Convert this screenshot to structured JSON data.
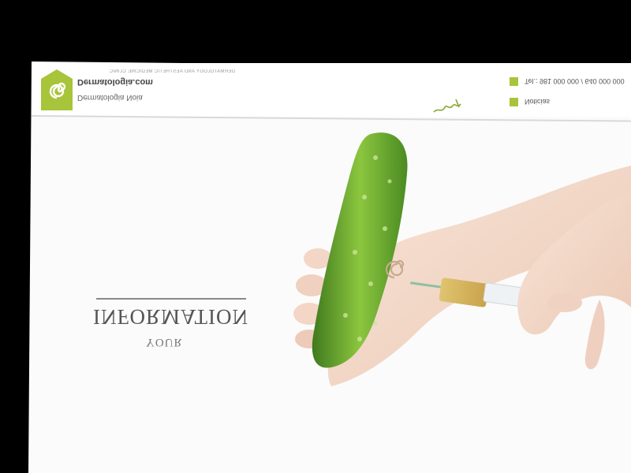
{
  "header": {
    "brand_small": "DERMATOLOGY AND AESTHETIC MEDICINE CLINIC",
    "brand_name": "Dermatologia.com",
    "brand_tag": "Dermatologia Noia",
    "contacts": [
      {
        "label": "Tel.: 981 000 000 / 640 000 000",
        "icon": "phone-icon"
      },
      {
        "label": "Noticias",
        "icon": "news-icon"
      }
    ]
  },
  "hero": {
    "title": "INFORMATION",
    "subtitle": "YOUR"
  },
  "colors": {
    "accent": "#a8c43a",
    "background": "#fbfbfb",
    "frame": "#000000"
  }
}
